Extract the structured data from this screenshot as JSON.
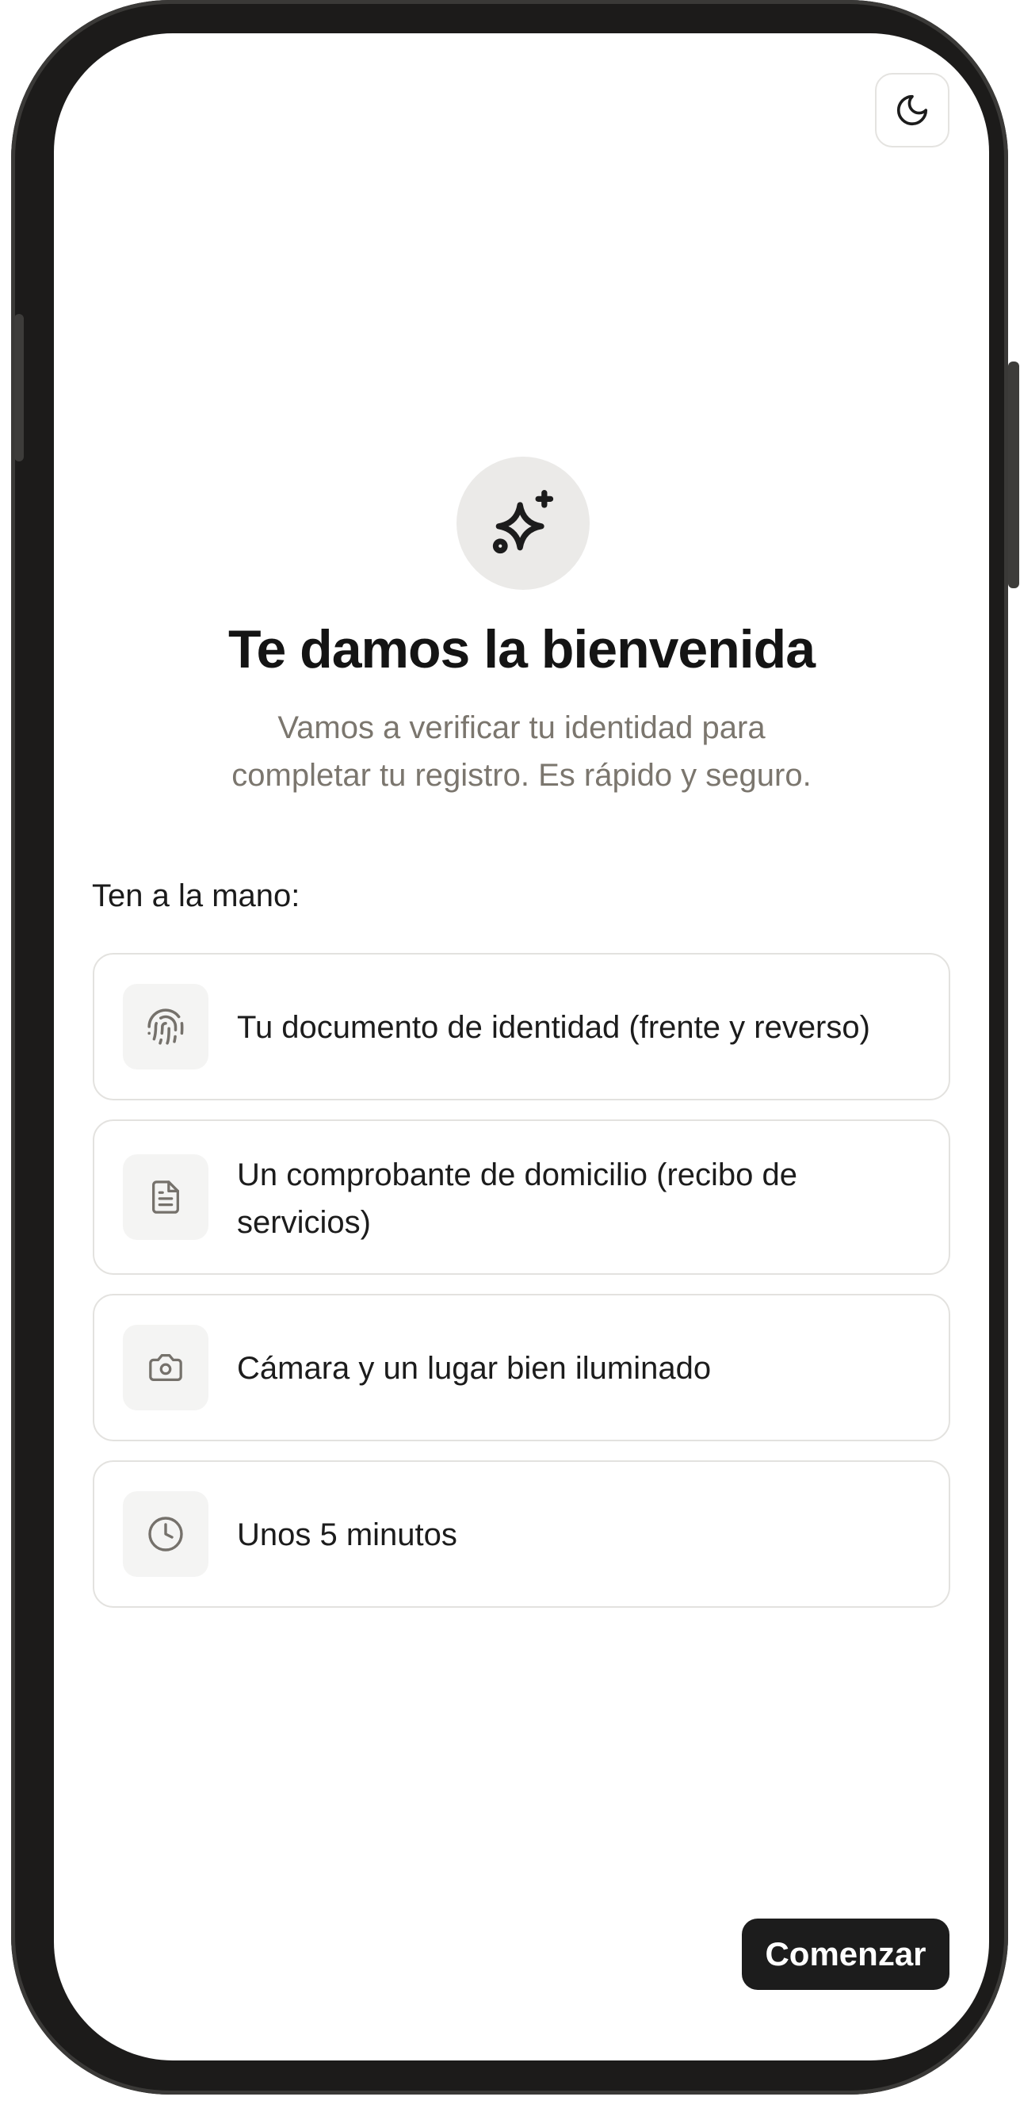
{
  "header": {
    "theme_toggle_icon": "moon-icon"
  },
  "hero": {
    "icon": "sparkles-icon",
    "title": "Te damos la bienvenida",
    "subtitle": "Vamos a verificar tu identidad para completar tu registro. Es rápido y seguro."
  },
  "requirements": {
    "label": "Ten a la mano:",
    "items": [
      {
        "icon": "fingerprint-icon",
        "text": "Tu documento de identidad (frente y reverso)"
      },
      {
        "icon": "document-icon",
        "text": "Un comprobante de domicilio (recibo de servicios)"
      },
      {
        "icon": "camera-icon",
        "text": "Cámara y un lugar bien iluminado"
      },
      {
        "icon": "clock-icon",
        "text": "Unos 5 minutos"
      }
    ]
  },
  "actions": {
    "start_label": "Comenzar"
  },
  "colors": {
    "accent": "#1c1c1c",
    "muted_text": "#7b766e",
    "border": "#e3e2df"
  }
}
